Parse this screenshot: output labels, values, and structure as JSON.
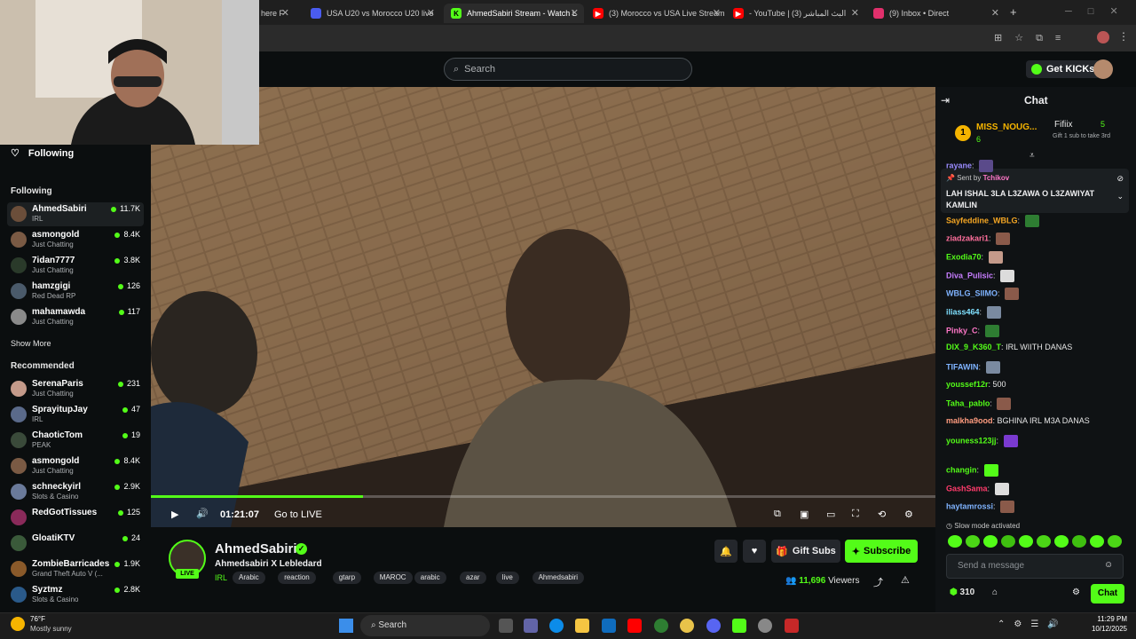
{
  "browser": {
    "tabs": [
      {
        "title": "here F",
        "icon": "web-icon",
        "color": "#1f1f1f"
      },
      {
        "title": "USA U20 vs Morocco U20 live",
        "icon": "web-icon",
        "color": "#4a5cf0"
      },
      {
        "title": "AhmedSabiri Stream - Watch L",
        "icon": "kick-icon",
        "color": "#53fc18"
      },
      {
        "title": "(3) Morocco vs USA Live Stream",
        "icon": "youtube-icon",
        "color": "#ff0000"
      },
      {
        "title": "- YouTube | البث المباشر (3)",
        "icon": "youtube-icon",
        "color": "#ff0000"
      },
      {
        "title": "(9) Inbox • Direct",
        "icon": "instagram-icon",
        "color": "#e1306c"
      }
    ]
  },
  "header": {
    "search_placeholder": "Search",
    "get_kicks": "Get KICKs"
  },
  "sidebar": {
    "following_header": "Following",
    "following_label": "Following",
    "following": [
      {
        "name": "AhmedSabiri",
        "category": "IRL",
        "viewers": "11.7K",
        "avatar": "#6b4e3a"
      },
      {
        "name": "asmongold",
        "category": "Just Chatting",
        "viewers": "8.4K",
        "avatar": "#7a5a44"
      },
      {
        "name": "7idan7777",
        "category": "Just Chatting",
        "viewers": "3.8K",
        "avatar": "#2a3a2a"
      },
      {
        "name": "hamzgigi",
        "category": "Red Dead RP",
        "viewers": "126",
        "avatar": "#4a5a6a"
      },
      {
        "name": "mahamawda",
        "category": "Just Chatting",
        "viewers": "117",
        "avatar": "#8a8a8a"
      }
    ],
    "show_more": "Show More",
    "recommended_label": "Recommended",
    "recommended": [
      {
        "name": "SerenaParis",
        "category": "Just Chatting",
        "viewers": "231",
        "avatar": "#c49a8a"
      },
      {
        "name": "SprayitupJay",
        "category": "IRL",
        "viewers": "47",
        "avatar": "#5a6a8a"
      },
      {
        "name": "ChaoticTom",
        "category": "PEAK",
        "viewers": "19",
        "avatar": "#3a4a3a"
      },
      {
        "name": "asmongold",
        "category": "Just Chatting",
        "viewers": "8.4K",
        "avatar": "#7a5a44"
      },
      {
        "name": "schneckyirl",
        "category": "Slots & Casino",
        "viewers": "2.9K",
        "avatar": "#6a7a9a"
      },
      {
        "name": "RedGotTissues",
        "category": "",
        "viewers": "125",
        "avatar": "#8a2a5a"
      },
      {
        "name": "GloatiKTV",
        "category": "",
        "viewers": "24",
        "avatar": "#3a5a3a"
      },
      {
        "name": "ZombieBarricades",
        "category": "Grand Theft Auto V (...",
        "viewers": "1.9K",
        "avatar": "#8a5a2a"
      },
      {
        "name": "Syztmz",
        "category": "Slots & Casino",
        "viewers": "2.8K",
        "avatar": "#2a5a8a"
      }
    ]
  },
  "player": {
    "time": "01:21:07",
    "go_live": "Go to LIVE",
    "progress": 0.27
  },
  "stream": {
    "channel": "AhmedSabiri",
    "title": "Ahmedsabiri X Lebledard",
    "live": "LIVE",
    "category": "IRL",
    "tags": [
      "Arabic",
      "reaction",
      "gtarp",
      "MAROC",
      "arabic",
      "azar",
      "live",
      "Ahmedsabiri"
    ],
    "gift_subs": "Gift Subs",
    "subscribe": "Subscribe",
    "viewers": "11,696",
    "viewers_label": "Viewers"
  },
  "chat": {
    "title": "Chat",
    "leaderboard": [
      {
        "rank": "1",
        "name": "MISS_NOUG...",
        "count": "6"
      },
      {
        "name": "Fifiix",
        "count": "5",
        "sub": "Gift 1 sub to take 3rd"
      }
    ],
    "pinned": {
      "sent_by": "Sent by",
      "author": "Tchikov",
      "message": "LAH ISHAL 3LA L3ZAWA O L3ZAWIYAT KAMLIN"
    },
    "messages": [
      {
        "user": "rayane",
        "text": "",
        "color": "#9b8cff"
      },
      {
        "user": "Sayfeddine_WBLG",
        "text": "",
        "color": "#f5a623"
      },
      {
        "user": "ziadzakari1",
        "text": "",
        "color": "#ff6f9c"
      },
      {
        "user": "Exodia70",
        "text": "",
        "color": "#53fc18"
      },
      {
        "user": "Diva_Pulisic",
        "text": "",
        "color": "#c77dff"
      },
      {
        "user": "WBLG_SIIMO",
        "text": "",
        "color": "#7fb3ff"
      },
      {
        "user": "iliass464",
        "text": "",
        "color": "#7fe0ff"
      },
      {
        "user": "Pinky_C",
        "text": "",
        "color": "#ff77c8"
      },
      {
        "user": "DIX_9_K360_T",
        "text": "IRL WIITH DANAS",
        "color": "#53fc18"
      },
      {
        "user": "TIFAWIN",
        "text": "",
        "color": "#7fb3ff"
      },
      {
        "user": "youssef12r",
        "text": "500",
        "color": "#53fc18"
      },
      {
        "user": "Taha_pablo",
        "text": "",
        "color": "#53fc18"
      },
      {
        "user": "malkha9ood",
        "text": "BGHINA IRL M3A DANAS",
        "color": "#ff9c7f"
      },
      {
        "user": "youness123jj",
        "text": "",
        "color": "#53fc18"
      },
      {
        "user": "changin",
        "text": "",
        "color": "#53fc18"
      },
      {
        "user": "GashSama",
        "text": "",
        "color": "#ff3b6b"
      },
      {
        "user": "haytamrossi",
        "text": "",
        "color": "#7fb3ff"
      }
    ],
    "slow_mode": "Slow mode activated",
    "input_placeholder": "Send a message",
    "points": "310",
    "send": "Chat"
  },
  "taskbar": {
    "weather_temp": "76°F",
    "weather_desc": "Mostly sunny",
    "search": "Search",
    "time": "11:29 PM",
    "date": "10/12/2025"
  },
  "colors": {
    "kick_green": "#53fc18",
    "bg": "#0b0e0f",
    "chat_bg": "#0f1214"
  }
}
